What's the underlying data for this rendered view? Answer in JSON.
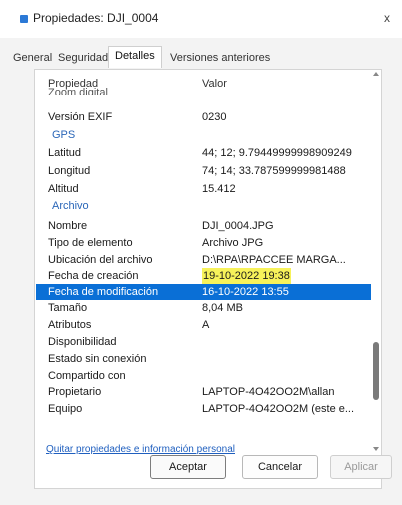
{
  "window": {
    "title": "Propiedades: DJI_0004",
    "close_glyph": "x"
  },
  "tabs": [
    "General",
    "Seguridad",
    "Detalles",
    "Versiones anteriores"
  ],
  "active_tab": "Detalles",
  "columns": {
    "property": "Propiedad",
    "value": "Valor"
  },
  "rows": [
    {
      "type": "header",
      "k": "Zoom digital",
      "v": ""
    },
    {
      "type": "prop",
      "k": "Versión EXIF",
      "v": "0230"
    },
    {
      "type": "group",
      "k": "GPS"
    },
    {
      "type": "prop",
      "k": "Latitud",
      "v": "44; 12; 9.79449999998909249"
    },
    {
      "type": "prop",
      "k": "Longitud",
      "v": "74; 14; 33.787599999981488"
    },
    {
      "type": "prop",
      "k": "Altitud",
      "v": "15.412"
    },
    {
      "type": "group",
      "k": "Archivo"
    },
    {
      "type": "prop",
      "k": "Nombre",
      "v": "DJI_0004.JPG"
    },
    {
      "type": "prop",
      "k": "Tipo de elemento",
      "v": "Archivo JPG"
    },
    {
      "type": "prop",
      "k": "Ubicación del archivo",
      "v": "D:\\RPA\\RPACCEE MARGA..."
    },
    {
      "type": "prop",
      "k": "Fecha de creación",
      "v": "19-10-2022 19:38",
      "highlight": true
    },
    {
      "type": "prop",
      "k": "Fecha de modificación",
      "v": "16-10-2022 13:55",
      "selected": true
    },
    {
      "type": "prop",
      "k": "Tamaño",
      "v": "8,04 MB"
    },
    {
      "type": "prop",
      "k": "Atributos",
      "v": "A"
    },
    {
      "type": "prop",
      "k": "Disponibilidad",
      "v": ""
    },
    {
      "type": "prop",
      "k": "Estado sin conexión",
      "v": ""
    },
    {
      "type": "prop",
      "k": "Compartido con",
      "v": ""
    },
    {
      "type": "prop",
      "k": "Propietario",
      "v": "LAPTOP-4O42OO2M\\allan"
    },
    {
      "type": "prop",
      "k": "Equipo",
      "v": "LAPTOP-4O42OO2M (este e..."
    }
  ],
  "remove_link": "Quitar propiedades e información personal",
  "buttons": {
    "ok": "Aceptar",
    "cancel": "Cancelar",
    "apply": "Aplicar"
  },
  "colors": {
    "selection": "#0a6fd6",
    "highlight": "#f7f25a",
    "group": "#2a66b8"
  }
}
